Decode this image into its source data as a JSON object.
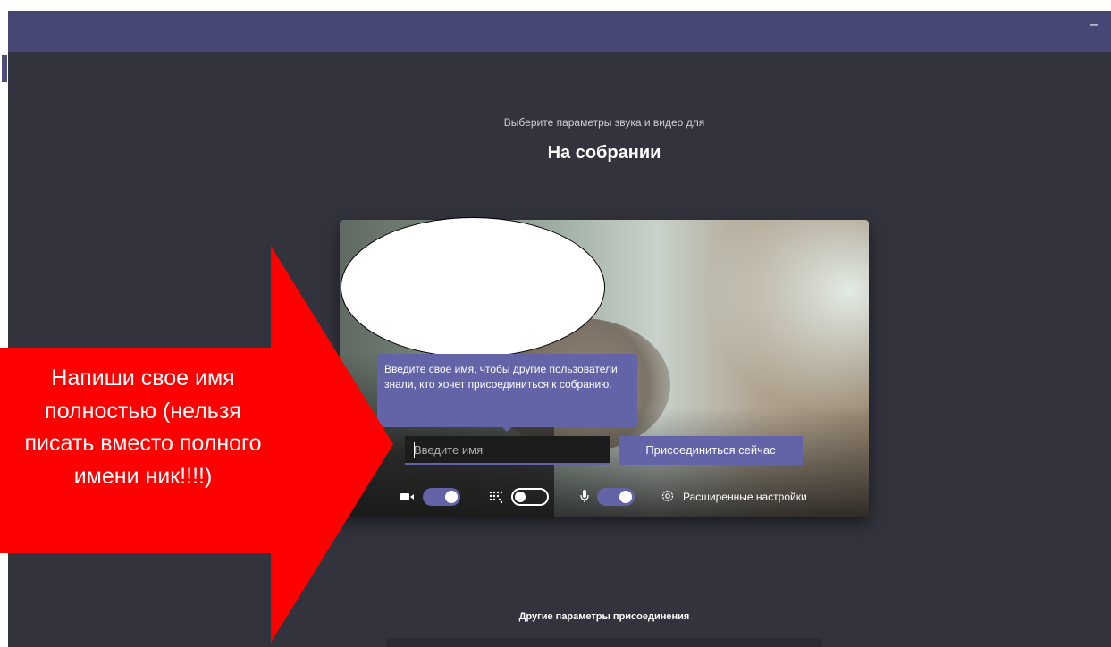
{
  "window": {
    "minimize_label": "–"
  },
  "header": {
    "subtitle": "Выберите параметры звука и видео для",
    "title": "На собрании"
  },
  "tooltip": {
    "text": "Введите свое имя, чтобы другие пользователи знали, кто хочет присоединиться к собранию."
  },
  "join": {
    "name_placeholder": "Введите имя",
    "name_value": "",
    "join_button_label": "Присоединиться сейчас"
  },
  "controls": {
    "camera": {
      "icon": "video-camera-icon",
      "state": "on"
    },
    "background_blur": {
      "icon": "background-blur-icon",
      "state": "off"
    },
    "microphone": {
      "icon": "microphone-icon",
      "state": "on"
    },
    "advanced_settings": {
      "icon": "gear-icon",
      "label": "Расширенные настройки"
    }
  },
  "footer": {
    "other_options_label": "Другие параметры присоединения"
  },
  "annotation": {
    "lines": [
      "Напиши свое имя",
      "полностью (нельзя",
      "писать вместо полного",
      "имени ник!!!!)"
    ],
    "color": "#ff0000"
  },
  "colors": {
    "accent": "#6264a7",
    "titlebar": "#464775",
    "background": "#33333e"
  }
}
